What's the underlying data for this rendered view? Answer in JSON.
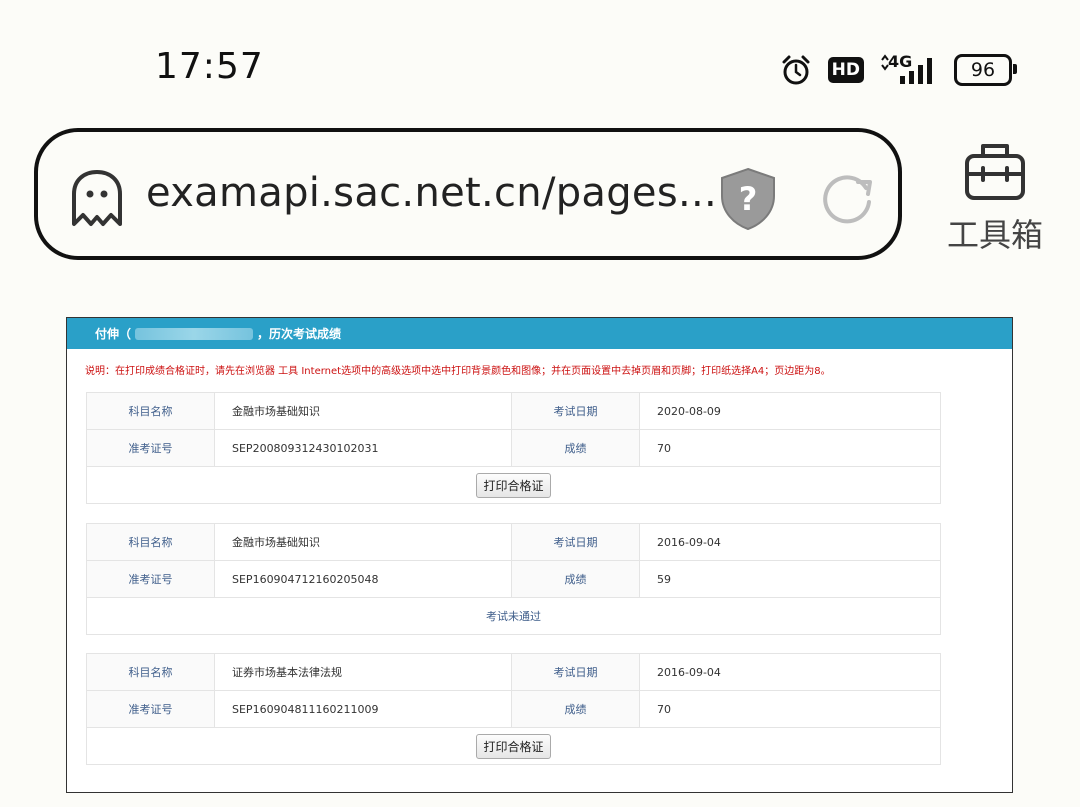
{
  "status_bar": {
    "time": "17:57",
    "hd": "HD",
    "network": "4G",
    "battery": "96"
  },
  "address_bar": {
    "url": "examapi.sac.net.cn/pages..."
  },
  "toolbox": {
    "label": "工具箱"
  },
  "page": {
    "header_name": "付伸（",
    "header_suffix": "，历次考试成绩",
    "note": "说明：在打印成绩合格证时，请先在浏览器 工具 Internet选项中的高级选项中选中打印背景颜色和图像；并在页面设置中去掉页眉和页脚；打印纸选择A4；页边距为8。",
    "labels": {
      "subject": "科目名称",
      "date": "考试日期",
      "ticket": "准考证号",
      "score": "成绩"
    },
    "records": [
      {
        "subject": "金融市场基础知识",
        "date": "2020-08-09",
        "ticket": "SEP200809312430102031",
        "score": "70",
        "action": "打印合格证"
      },
      {
        "subject": "金融市场基础知识",
        "date": "2016-09-04",
        "ticket": "SEP160904712160205048",
        "score": "59",
        "status": "考试未通过"
      },
      {
        "subject": "证券市场基本法律法规",
        "date": "2016-09-04",
        "ticket": "SEP160904811160211009",
        "score": "70",
        "action": "打印合格证"
      }
    ]
  }
}
